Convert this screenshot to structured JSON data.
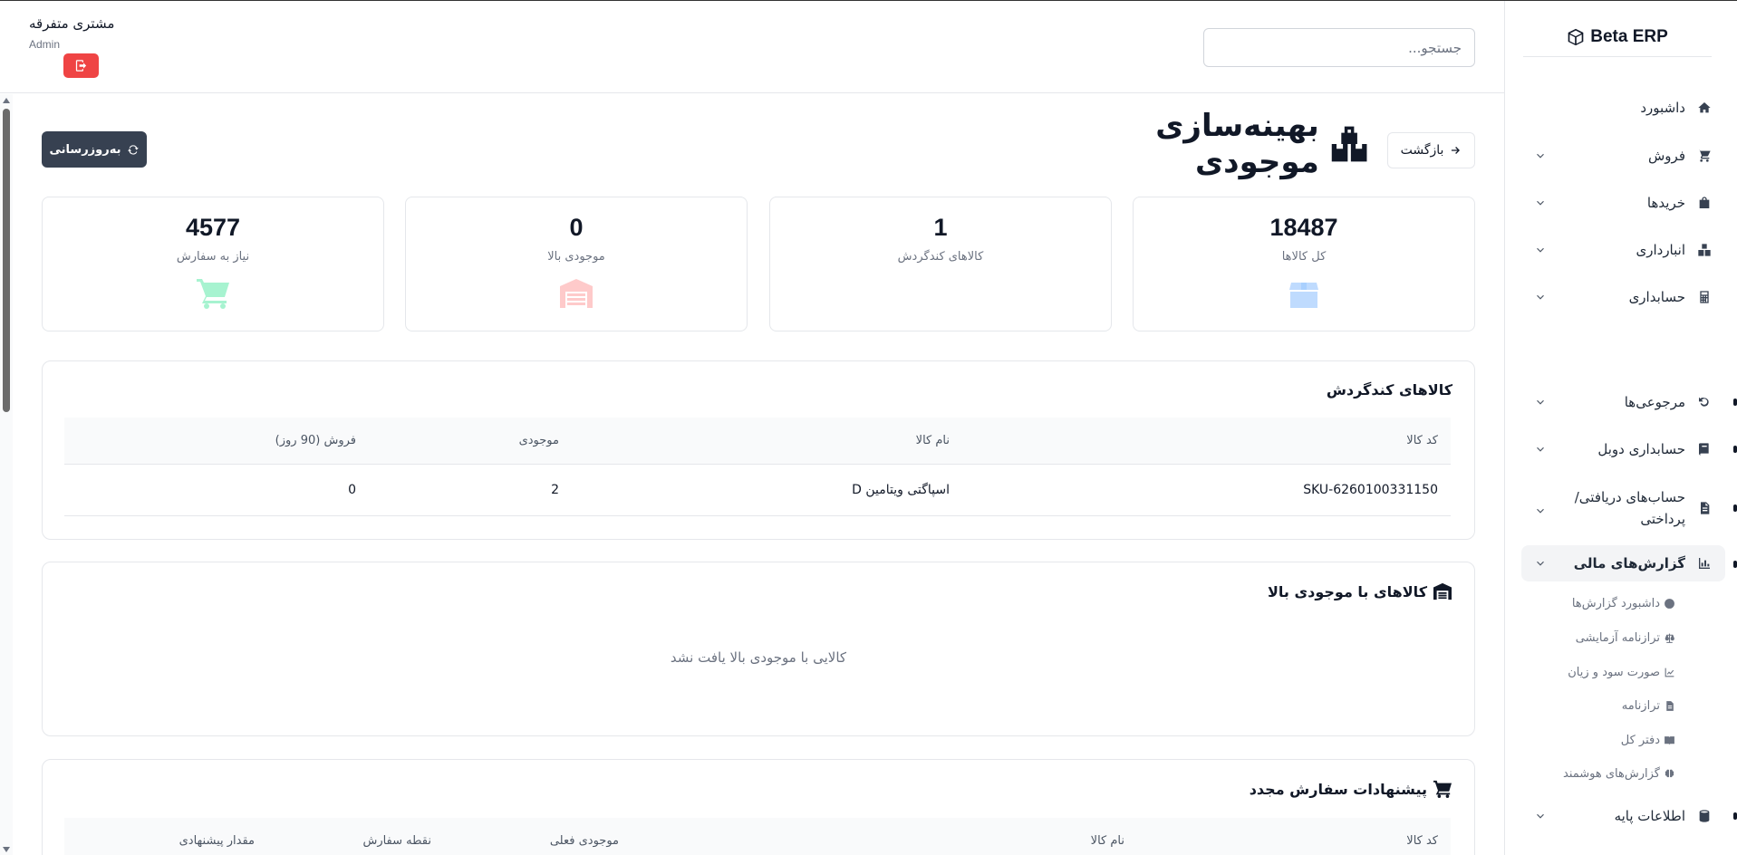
{
  "app": {
    "brand": "Beta ERP",
    "user_name": "مشتری متفرقه",
    "user_role": "Admin"
  },
  "search": {
    "placeholder": "جستجو..."
  },
  "sidebar": {
    "items": [
      {
        "label": "داشبورد",
        "icon": "home-icon"
      },
      {
        "label": "فروش",
        "icon": "cart-icon"
      },
      {
        "label": "خریدها",
        "icon": "bag-icon"
      },
      {
        "label": "انبارداری",
        "icon": "boxes-icon"
      },
      {
        "label": "حسابداری",
        "icon": "calculator-icon"
      },
      {
        "label": "مرجوعی‌ها",
        "icon": "undo-icon"
      },
      {
        "label": "حسابداری دوبل",
        "icon": "book-icon"
      },
      {
        "label": "حساب‌های دریافتی/\nپرداختی",
        "icon": "invoice-icon"
      },
      {
        "label": "گزارش‌های مالی",
        "icon": "chart-icon"
      },
      {
        "label": "اطلاعات پایه",
        "icon": "database-icon"
      }
    ],
    "sub_items": [
      {
        "label": "داشبورد گزارش‌ها",
        "icon": "gauge-icon"
      },
      {
        "label": "ترازنامه آزمایشی",
        "icon": "scale-icon"
      },
      {
        "label": "صورت سود و زیان",
        "icon": "line-chart-icon"
      },
      {
        "label": "ترازنامه",
        "icon": "file-icon"
      },
      {
        "label": "دفتر کل",
        "icon": "open-book-icon"
      },
      {
        "label": "گزارش‌های هوشمند",
        "icon": "brain-icon"
      }
    ]
  },
  "page": {
    "title": "بهینه‌سازی موجودی",
    "back_label": "بازگشت",
    "refresh_label": "به‌روزرسانی"
  },
  "stats": [
    {
      "value": "18487",
      "label": "کل کالاها",
      "icon": "box-icon",
      "color": "#bfdbfe"
    },
    {
      "value": "1",
      "label": "کالاهای کندگردش",
      "icon": "boxes-icon",
      "color": "#e5e7eb"
    },
    {
      "value": "0",
      "label": "موجودی بالا",
      "icon": "warehouse-icon",
      "color": "#fecaca"
    },
    {
      "value": "4577",
      "label": "نیاز به سفارش",
      "icon": "cart-icon",
      "color": "#a7f3d0"
    }
  ],
  "slow_moving": {
    "title": "کالاهای کندگردش",
    "columns": [
      "کد کالا",
      "نام کالا",
      "موجودی",
      "فروش (90 روز)"
    ],
    "rows": [
      [
        "SKU-6260100331150",
        "اسپاگتی ویتامین D",
        "2",
        "0"
      ]
    ]
  },
  "high_stock": {
    "title": "کالاهای با موجودی بالا",
    "empty_message": "کالایی با موجودی بالا یافت نشد"
  },
  "reorder": {
    "title": "پیشنهادات سفارش مجدد",
    "columns": [
      "کد کالا",
      "نام کالا",
      "موجودی فعلی",
      "نقطه سفارش",
      "مقدار پیشنهادی"
    ]
  }
}
